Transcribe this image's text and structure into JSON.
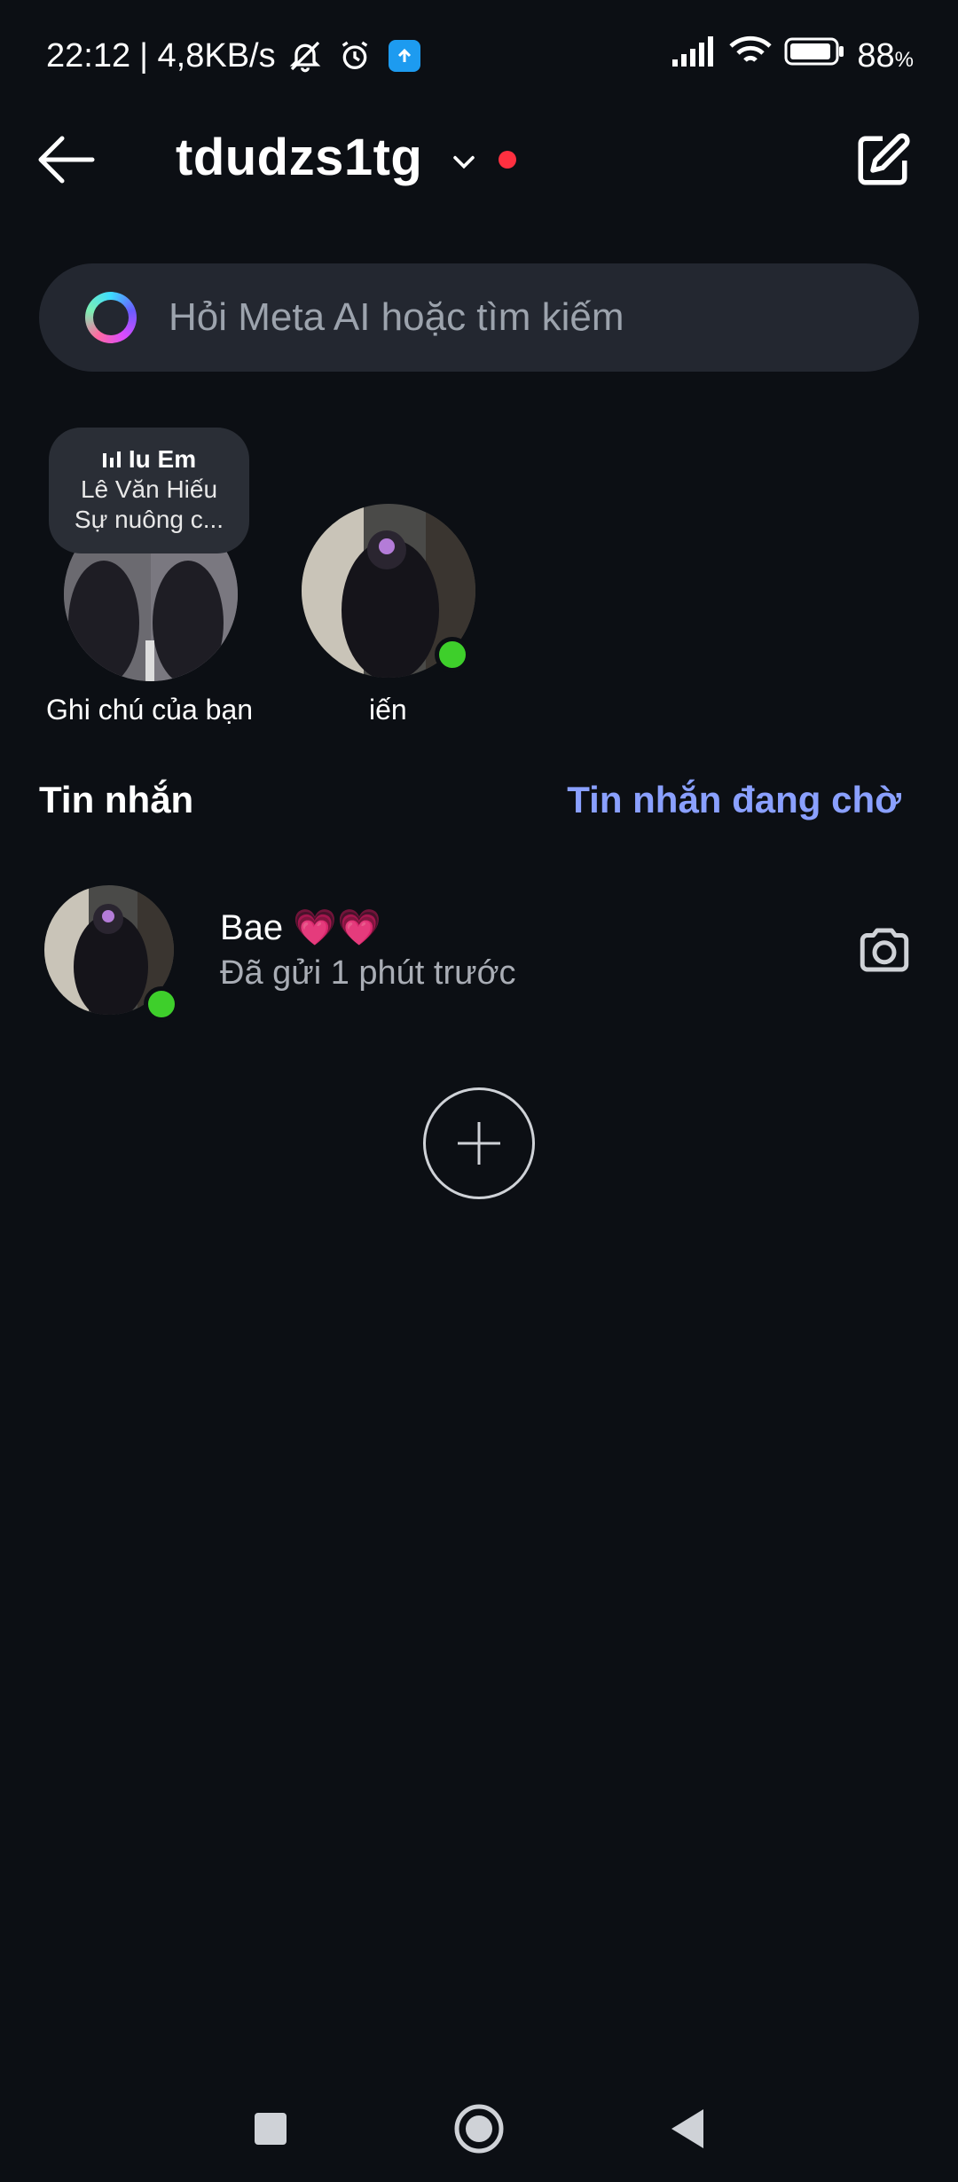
{
  "status_bar": {
    "time": "22:12",
    "net_speed": "| 4,8KB/s",
    "battery": "88",
    "battery_unit": "%",
    "icons": [
      "muted-bell-icon",
      "alarm-icon",
      "upload-icon",
      "signal-icon",
      "wifi-icon",
      "battery-icon"
    ]
  },
  "header": {
    "account_name": "tdudzs1tg",
    "icons": [
      "back-arrow-icon",
      "chevron-down-icon",
      "compose-icon"
    ],
    "unread_dot_color": "#ff3040"
  },
  "search": {
    "placeholder": "Hỏi Meta AI hoặc tìm kiếm"
  },
  "notes": [
    {
      "label": "Ghi chú của bạn",
      "bubble": {
        "title": "Iu Em",
        "artist": "Lê Văn Hiếu",
        "text": "Sự nuông c..."
      }
    },
    {
      "label": "iến",
      "online": true
    }
  ],
  "messages": {
    "title": "Tin nhắn",
    "requests_label": "Tin nhắn đang chờ",
    "threads": [
      {
        "name": "Bae 💗💗",
        "subtitle": "Đã gửi 1 phút trước",
        "online": true
      }
    ]
  },
  "colors": {
    "background": "#0c0f14",
    "accent_link": "#8aa0ff",
    "online": "#3ecf2b"
  },
  "nav_bar": {
    "icons": [
      "recents-square-icon",
      "home-circle-icon",
      "back-triangle-icon"
    ]
  }
}
